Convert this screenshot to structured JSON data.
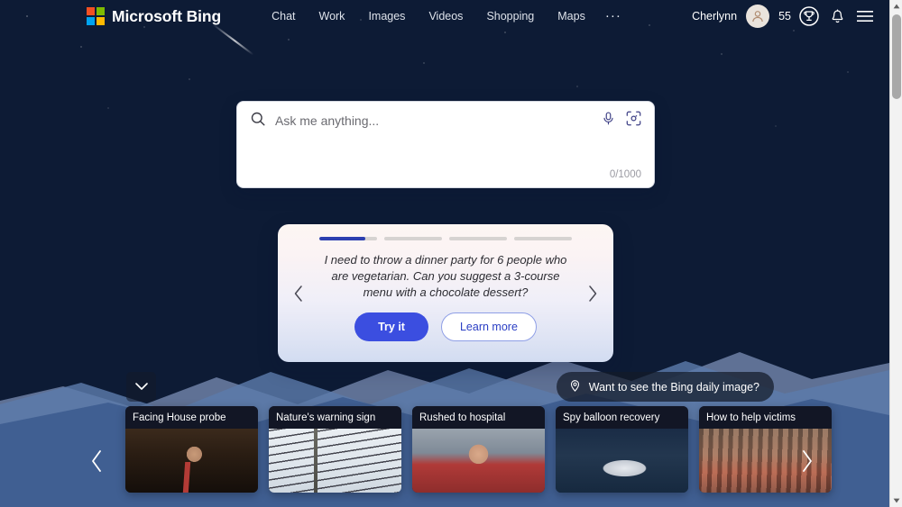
{
  "brand": {
    "name": "Microsoft Bing",
    "logo_icon": "microsoft-squares-icon"
  },
  "nav": {
    "items": [
      {
        "label": "Chat"
      },
      {
        "label": "Work"
      },
      {
        "label": "Images"
      },
      {
        "label": "Videos"
      },
      {
        "label": "Shopping"
      },
      {
        "label": "Maps"
      }
    ],
    "more_label": "···"
  },
  "account": {
    "username": "Cherlynn",
    "avatar_icon": "person-avatar-icon",
    "points": "55",
    "rewards_icon": "trophy-icon",
    "notifications_icon": "bell-icon",
    "menu_icon": "hamburger-menu-icon"
  },
  "search": {
    "placeholder": "Ask me anything...",
    "value": "",
    "search_icon": "search-icon",
    "mic_icon": "microphone-icon",
    "lens_icon": "visual-search-icon",
    "char_count": "0/1000"
  },
  "suggestion_card": {
    "progress": [
      {
        "percent": 80
      },
      {
        "percent": 0
      },
      {
        "percent": 0
      },
      {
        "percent": 0
      }
    ],
    "prompt": "I need to throw a dinner party for 6 people who are vegetarian. Can you suggest a 3-course menu with a chocolate dessert?",
    "primary_button": "Try it",
    "secondary_button": "Learn more",
    "prev_icon": "chevron-left-icon",
    "next_icon": "chevron-right-icon",
    "accent_color": "#3b4ee0"
  },
  "daily_image": {
    "label": "Want to see the Bing daily image?",
    "pin_icon": "location-pin-icon"
  },
  "collapse": {
    "icon": "chevron-down-icon"
  },
  "news": {
    "prev_icon": "chevron-left-icon",
    "next_icon": "chevron-right-icon",
    "cards": [
      {
        "title": "Facing House probe",
        "art": "th-congress"
      },
      {
        "title": "Nature's warning sign",
        "art": "th-wires"
      },
      {
        "title": "Rushed to hospital",
        "art": "th-crowd"
      },
      {
        "title": "Spy balloon recovery",
        "art": "th-balloon"
      },
      {
        "title": "How to help victims",
        "art": "th-aid"
      }
    ]
  },
  "scrollbar": {
    "up_icon": "scroll-up-arrow-icon",
    "down_icon": "scroll-down-arrow-icon"
  }
}
